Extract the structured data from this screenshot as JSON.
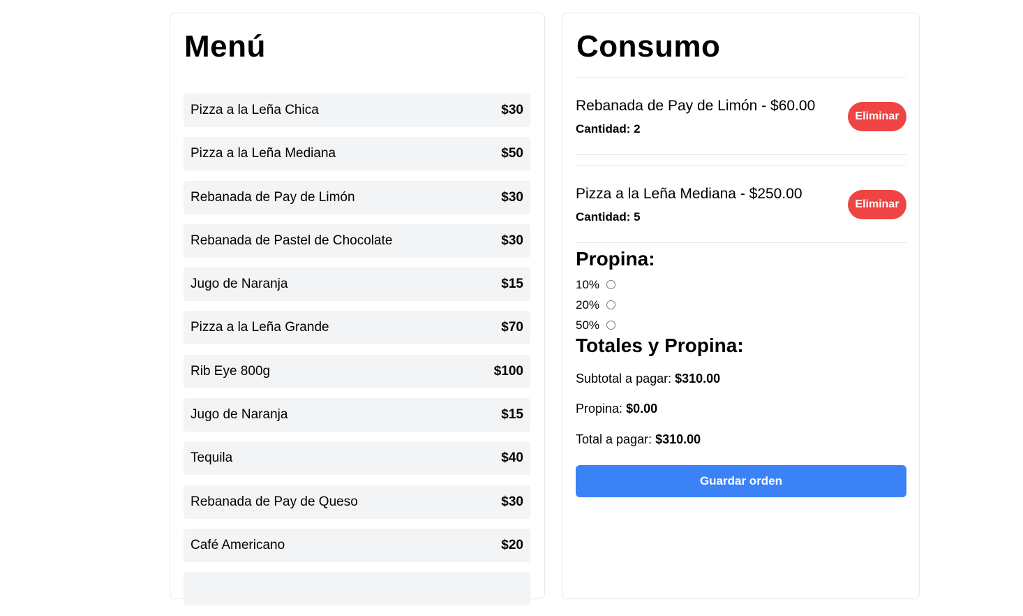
{
  "menu": {
    "title": "Menú",
    "items": [
      {
        "name": "Pizza a la Leña Chica",
        "price": "$30"
      },
      {
        "name": "Pizza a la Leña Mediana",
        "price": "$50"
      },
      {
        "name": "Rebanada de Pay de Limón",
        "price": "$30"
      },
      {
        "name": "Rebanada de Pastel de Chocolate",
        "price": "$30"
      },
      {
        "name": "Jugo de Naranja",
        "price": "$15"
      },
      {
        "name": "Pizza a la Leña Grande",
        "price": "$70"
      },
      {
        "name": "Rib Eye 800g",
        "price": "$100"
      },
      {
        "name": "Jugo de Naranja",
        "price": "$15"
      },
      {
        "name": "Tequila",
        "price": "$40"
      },
      {
        "name": "Rebanada de Pay de Queso",
        "price": "$30"
      },
      {
        "name": "Café Americano",
        "price": "$20"
      },
      {
        "name": "",
        "price": ""
      }
    ]
  },
  "consumo": {
    "title": "Consumo",
    "orders": [
      {
        "line": "Rebanada de Pay de Limón - $60.00",
        "qty": "Cantidad: 2",
        "delete_label": "Eliminar"
      },
      {
        "line": "Pizza a la Leña Mediana - $250.00",
        "qty": "Cantidad: 5",
        "delete_label": "Eliminar"
      }
    ],
    "tip_title": "Propina:",
    "tip_options": [
      "10%",
      "20%",
      "50%"
    ],
    "totals_title": "Totales y Propina:",
    "subtotal_label": "Subtotal a pagar:",
    "subtotal_value": "$310.00",
    "tip_label": "Propina:",
    "tip_value": "$0.00",
    "total_label": "Total a pagar:",
    "total_value": "$310.00",
    "save_label": "Guardar orden"
  },
  "colors": {
    "delete_button": "#ef4444",
    "save_button": "#3b82f6",
    "menu_item_bg": "#f3f4f6"
  }
}
